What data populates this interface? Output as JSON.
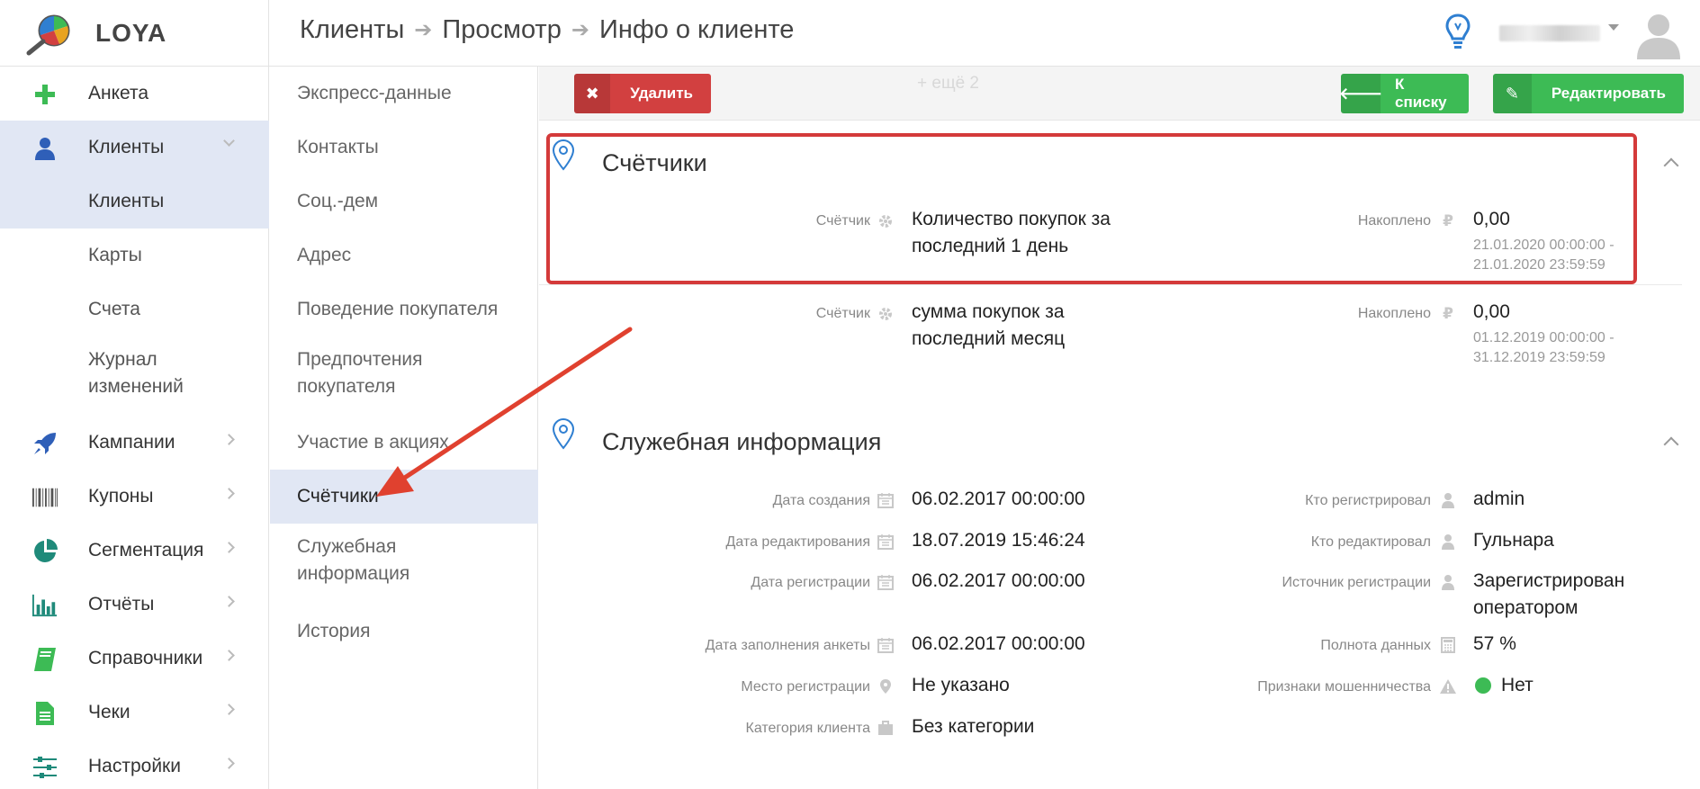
{
  "app": {
    "name": "LOYA"
  },
  "header": {
    "breadcrumb": [
      "Клиенты",
      "Просмотр",
      "Инфо о клиенте"
    ]
  },
  "sidebar": {
    "items": [
      {
        "label": "Анкета",
        "icon": "plus-icon"
      },
      {
        "label": "Клиенты",
        "icon": "user-icon",
        "active": true
      },
      {
        "label": "Клиенты",
        "sub": true,
        "active": true
      },
      {
        "label": "Карты",
        "sub": true
      },
      {
        "label": "Счета",
        "sub": true
      },
      {
        "label": "Журнал изменений",
        "sub": true
      },
      {
        "label": "Кампании",
        "icon": "rocket-icon"
      },
      {
        "label": "Купоны",
        "icon": "barcode-icon"
      },
      {
        "label": "Сегментация",
        "icon": "pie-chart-icon"
      },
      {
        "label": "Отчёты",
        "icon": "bar-chart-icon"
      },
      {
        "label": "Справочники",
        "icon": "book-icon"
      },
      {
        "label": "Чеки",
        "icon": "document-icon"
      },
      {
        "label": "Настройки",
        "icon": "sliders-icon"
      }
    ]
  },
  "section_menu": {
    "items": [
      {
        "label": "Экспресс-данные"
      },
      {
        "label": "Контакты"
      },
      {
        "label": "Соц.-дем"
      },
      {
        "label": "Адрес"
      },
      {
        "label": "Поведение покупателя"
      },
      {
        "label": "Предпочтения покупателя"
      },
      {
        "label": "Участие в акциях"
      },
      {
        "label": "Счётчики",
        "active": true
      },
      {
        "label": "Служебная информация"
      },
      {
        "label": "История"
      }
    ]
  },
  "toolbar": {
    "delete_label": "Удалить",
    "more_label": "+ ещё 2",
    "to_list_label": "К списку",
    "edit_label": "Редактировать"
  },
  "counters": {
    "title": "Счётчики",
    "rows": [
      {
        "counter_label": "Счётчик",
        "counter_value": "Количество покупок за последний 1 день",
        "accum_label": "Накоплено",
        "accum_value": "0,00",
        "period_from": "21.01.2020 00:00:00 -",
        "period_to": "21.01.2020 23:59:59"
      },
      {
        "counter_label": "Счётчик",
        "counter_value": "сумма покупок за последний месяц",
        "accum_label": "Накоплено",
        "accum_value": "0,00",
        "period_from": "01.12.2019 00:00:00 -",
        "period_to": "31.12.2019 23:59:59"
      }
    ]
  },
  "service": {
    "title": "Служебная информация",
    "left": [
      {
        "label": "Дата создания",
        "value": "06.02.2017 00:00:00",
        "icon": "calendar-icon"
      },
      {
        "label": "Дата редактирования",
        "value": "18.07.2019 15:46:24",
        "icon": "calendar-icon"
      },
      {
        "label": "Дата регистрации",
        "value": "06.02.2017 00:00:00",
        "icon": "calendar-icon"
      },
      {
        "label": "Дата заполнения анкеты",
        "value": "06.02.2017 00:00:00",
        "icon": "calendar-icon"
      },
      {
        "label": "Место регистрации",
        "value": "Не указано",
        "icon": "location-icon"
      },
      {
        "label": "Категория клиента",
        "value": "Без категории",
        "icon": "briefcase-icon"
      }
    ],
    "right": [
      {
        "label": "Кто регистрировал",
        "value": "admin",
        "icon": "user-icon"
      },
      {
        "label": "Кто редактировал",
        "value": "Гульнара",
        "icon": "user-icon"
      },
      {
        "label": "Источник регистрации",
        "value": "Зарегистрирован оператором",
        "icon": "user-icon"
      },
      {
        "label": "Полнота данных",
        "value": "57 %",
        "icon": "calculator-icon"
      },
      {
        "label": "Признаки мошенничества",
        "value": "Нет",
        "icon": "warning-icon",
        "status_color": "#3dbb55"
      }
    ]
  },
  "colors": {
    "accent_green": "#3dbb55",
    "danger_red": "#d24040",
    "active_bg": "#e1e7f4",
    "annotation_red": "#d43a3a"
  }
}
